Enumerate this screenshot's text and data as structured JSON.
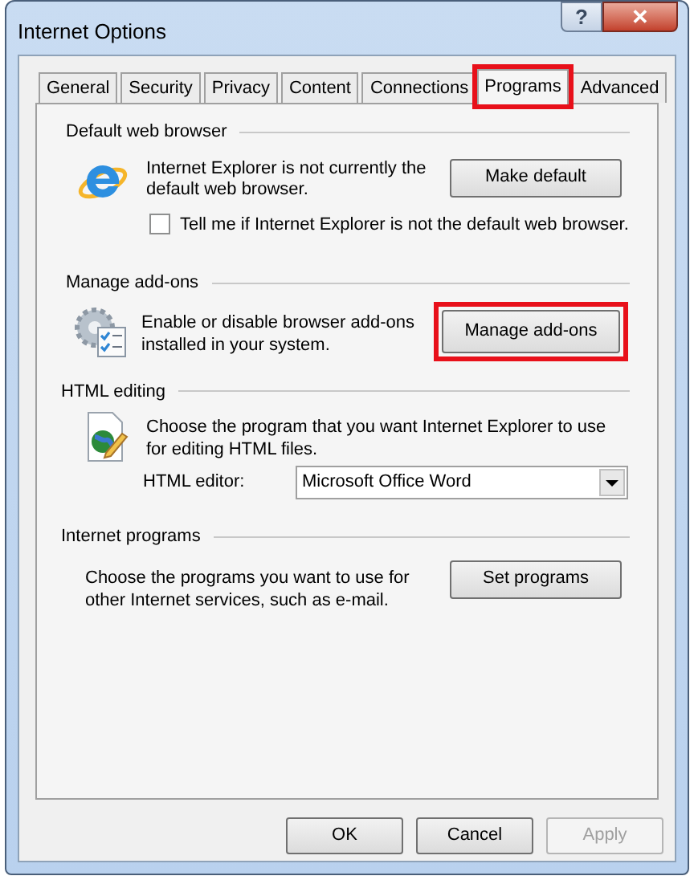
{
  "window": {
    "title": "Internet Options",
    "help": "?",
    "close": "✕"
  },
  "tabs": [
    {
      "label": "General",
      "selected": false,
      "highlighted": false
    },
    {
      "label": "Security",
      "selected": false,
      "highlighted": false
    },
    {
      "label": "Privacy",
      "selected": false,
      "highlighted": false
    },
    {
      "label": "Content",
      "selected": false,
      "highlighted": false
    },
    {
      "label": "Connections",
      "selected": false,
      "highlighted": false
    },
    {
      "label": "Programs",
      "selected": true,
      "highlighted": true
    },
    {
      "label": "Advanced",
      "selected": false,
      "highlighted": false
    }
  ],
  "default_browser": {
    "heading": "Default web browser",
    "text": "Internet Explorer is not currently the default web browser.",
    "button": {
      "label": "Make default",
      "highlighted": false
    },
    "checkbox": {
      "label": "Tell me if Internet Explorer is not the default web browser.",
      "checked": false
    }
  },
  "addons": {
    "heading": "Manage add-ons",
    "text": "Enable or disable browser add-ons installed in your system.",
    "button": {
      "label": "Manage add-ons",
      "highlighted": true
    }
  },
  "html_editing": {
    "heading": "HTML editing",
    "text": "Choose the program that you want Internet Explorer to use for editing HTML files.",
    "editor_label": "HTML editor:",
    "editor_value": "Microsoft Office Word"
  },
  "internet_programs": {
    "heading": "Internet programs",
    "text": "Choose the programs you want to use for other Internet services, such as e-mail.",
    "button": {
      "label": "Set programs",
      "highlighted": false
    }
  },
  "buttons": [
    {
      "label": "OK",
      "disabled": false
    },
    {
      "label": "Cancel",
      "disabled": false
    },
    {
      "label": "Apply",
      "disabled": true
    }
  ]
}
